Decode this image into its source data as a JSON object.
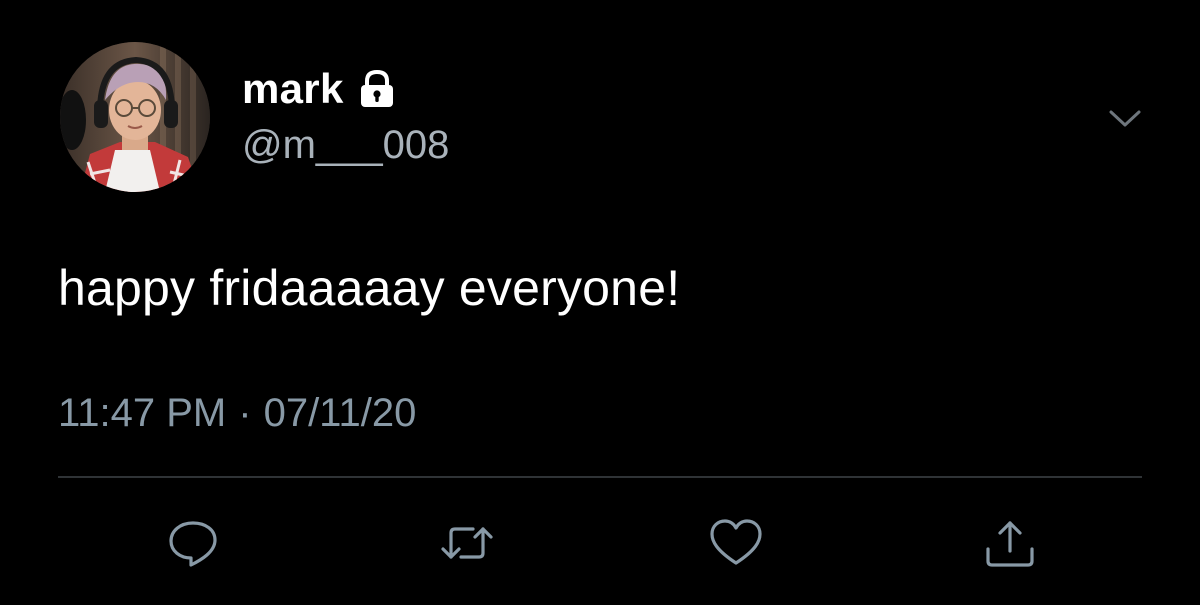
{
  "user": {
    "display_name": "mark",
    "handle": "@m___008",
    "protected_icon": "lock-icon",
    "avatar_icon": "profile-photo"
  },
  "menu": {
    "icon": "chevron-down-icon"
  },
  "tweet": {
    "text": "happy fridaaaaay everyone!",
    "time": "11:47 PM",
    "separator": "·",
    "date": "07/11/20"
  },
  "actions": [
    {
      "name": "reply",
      "icon": "comment-icon"
    },
    {
      "name": "retweet",
      "icon": "retweet-icon"
    },
    {
      "name": "like",
      "icon": "heart-icon"
    },
    {
      "name": "share",
      "icon": "share-icon"
    }
  ],
  "colors": {
    "background": "#000000",
    "primary_text": "#ffffff",
    "secondary_text": "#8899a6",
    "icon": "#8899a6",
    "divider": "#2f3336"
  }
}
